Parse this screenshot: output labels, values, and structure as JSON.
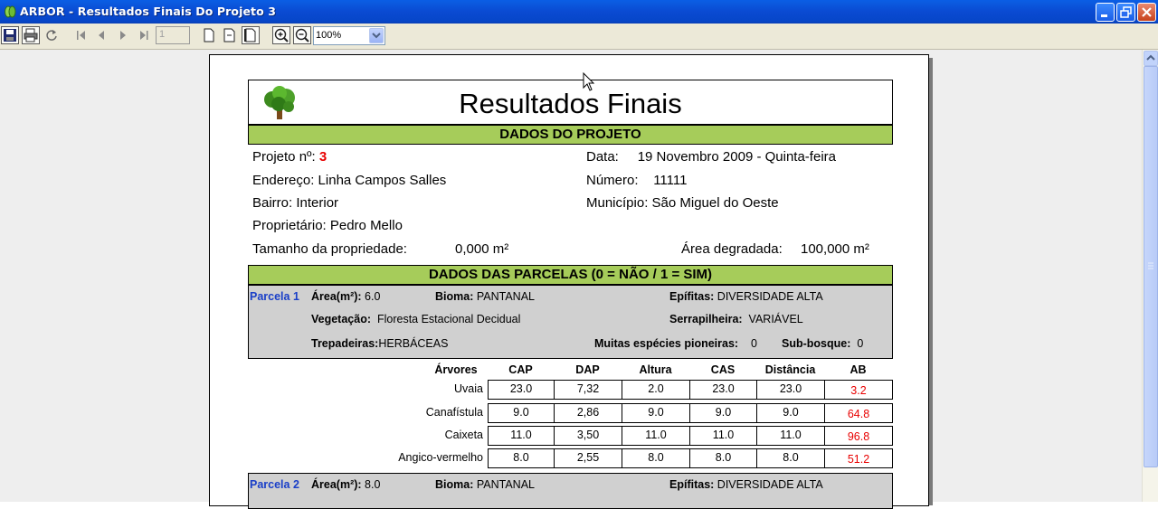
{
  "window": {
    "title": "ARBOR - Resultados Finais Do Projeto 3"
  },
  "toolbar": {
    "page_number": "1",
    "zoom": "100%"
  },
  "report": {
    "title": "Resultados Finais",
    "section_project": "DADOS DO PROJETO",
    "project_no_label": "Projeto nº:",
    "project_no": "3",
    "data_label": "Data:",
    "data_value": "19  Novembro 2009 - Quinta-feira",
    "endereco": "Endereço: Linha Campos Salles",
    "numero_label": "Número:",
    "numero_value": "11111",
    "bairro": "Bairro: Interior",
    "municipio": "Município: São Miguel do Oeste",
    "proprietario": "Proprietário:  Pedro Mello",
    "tamanho_label": "Tamanho da propriedade:",
    "tamanho_value": "0,000 m²",
    "area_deg_label": "Área degradada:",
    "area_deg_value": "100,000 m²",
    "section_parcels": "DADOS DAS PARCELAS (0 = NÃO / 1 = SIM)"
  },
  "parcels": [
    {
      "name": "Parcela 1",
      "area_label": "Área(m²):",
      "area": "6.0",
      "bioma_label": "Bioma:",
      "bioma": "PANTANAL",
      "epifitas_label": "Epífitas:",
      "epifitas": "DIVERSIDADE  ALTA",
      "vegetacao_label": "Vegetação:",
      "vegetacao": "Floresta Estacional Decidual",
      "serrapilheira_label": "Serrapilheira:",
      "serrapilheira": "VARIÁVEL",
      "trepadeiras_label": "Trepadeiras:",
      "trepadeiras": "HERBÁCEAS",
      "pioneiras_label": "Muitas espécies pioneiras:",
      "pioneiras": "0",
      "subbosque_label": "Sub-bosque:",
      "subbosque": "0"
    },
    {
      "name": "Parcela 2",
      "area_label": "Área(m²):",
      "area": "8.0",
      "bioma_label": "Bioma:",
      "bioma": "PANTANAL",
      "epifitas_label": "Epífitas:",
      "epifitas": "DIVERSIDADE  ALTA"
    }
  ],
  "trees_table": {
    "headers": [
      "Árvores",
      "CAP",
      "DAP",
      "Altura",
      "CAS",
      "Distância",
      "AB"
    ],
    "rows": [
      {
        "name": "Uvaia",
        "cap": "23.0",
        "dap": "7,32",
        "altura": "2.0",
        "cas": "23.0",
        "dist": "23.0",
        "ab": "3.2"
      },
      {
        "name": "Canafístula",
        "cap": "9.0",
        "dap": "2,86",
        "altura": "9.0",
        "cas": "9.0",
        "dist": "9.0",
        "ab": "64.8"
      },
      {
        "name": "Caixeta",
        "cap": "11.0",
        "dap": "3,50",
        "altura": "11.0",
        "cas": "11.0",
        "dist": "11.0",
        "ab": "96.8"
      },
      {
        "name": "Angico-vermelho",
        "cap": "8.0",
        "dap": "2,55",
        "altura": "8.0",
        "cas": "8.0",
        "dist": "8.0",
        "ab": "51.2"
      }
    ]
  },
  "colors": {
    "title_bar": "#0a4ad2",
    "section_green": "#a6cc5a",
    "parcel_grey": "#d0d0d0",
    "accent_red": "#e80000",
    "parcel_blue": "#1a3fc8"
  }
}
